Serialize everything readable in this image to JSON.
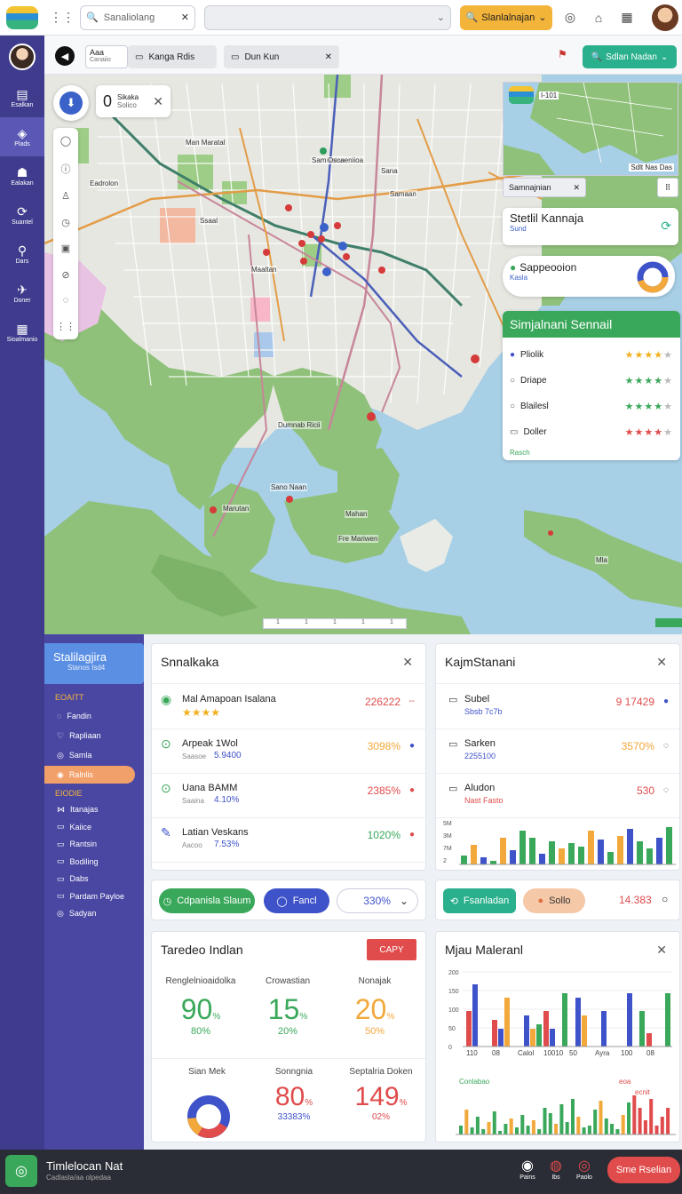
{
  "topbar": {
    "search_value": "Sanaliolang",
    "button_label": "Slanlalnajan",
    "icons": [
      "grid-icon",
      "search-icon",
      "close-icon",
      "chevron-icon",
      "compass-icon",
      "home-icon",
      "apps-icon"
    ]
  },
  "tabs": {
    "tab1_title": "Aaa",
    "tab1_sub": "Canaiio",
    "tab2": "Kanga Rdis",
    "tab3": "Dun Kun",
    "right_button": "Sdlan Nadan"
  },
  "sidebar": {
    "items": [
      {
        "label": "Esalkan",
        "icon": "inbox-icon"
      },
      {
        "label": "Plads",
        "icon": "layers-icon"
      },
      {
        "label": "Ealakan",
        "icon": "robot-icon"
      },
      {
        "label": "Suantel",
        "icon": "share-icon"
      },
      {
        "label": "Dars",
        "icon": "route-icon"
      },
      {
        "label": "Doner",
        "icon": "pin-icon"
      },
      {
        "label": "Sioalmanio",
        "icon": "calendar-icon"
      }
    ]
  },
  "map": {
    "popup_number": "0",
    "popup_title": "Sikaka",
    "popup_sub": "Solico",
    "labels": [
      "Man Maratal",
      "Samisalan",
      "Eadrolon",
      "Sana",
      "Oscaeniioa",
      "Samaan",
      "Ssaal",
      "Maaltan",
      "Dumnab Ricii",
      "Sano Naan",
      "Marutan",
      "Mahan",
      "Fre Mariwen",
      "Mla"
    ],
    "minimap_label": "Sdlt Nas Das",
    "minimap_tag": "I-101",
    "search_chip": "Samnajnian",
    "station_title": "Stetlil Kannaja",
    "station_sub": "Sund",
    "donut_title": "Sappeooion",
    "donut_sub": "Kasla",
    "list_title": "Simjalnani Sennail",
    "list_items": [
      {
        "label": "Pliolik",
        "rating": 4
      },
      {
        "label": "Driape",
        "rating": 4
      },
      {
        "label": "Blailesl",
        "rating": 4
      },
      {
        "label": "Doller",
        "rating": 4
      }
    ],
    "list_footer": "Rasch",
    "scale_ticks": [
      "1",
      "1",
      "1",
      "1",
      "1"
    ]
  },
  "left_menu": {
    "title": "Stalilagjira",
    "subtitle": "Stanos Isd4",
    "section1": "EOAITT",
    "items1": [
      "Fandin",
      "Rapliaan",
      "Samla",
      "Ralnlis"
    ],
    "section2": "EIODIE",
    "items2": [
      "Itanajas",
      "Kaiice",
      "Rantsin",
      "Bodiling",
      "Dabs",
      "Pardam Payloe",
      "Sadyan"
    ]
  },
  "panel1": {
    "title": "Snnalkaka",
    "rows": [
      {
        "title": "Mal Amapoan Isalana",
        "sub": "★★★★",
        "value": "226222",
        "suffix": "--",
        "color": "#e04b4b"
      },
      {
        "title": "Arpeak 1Wol",
        "sub": "Saasoe",
        "sub2": "5.9400",
        "value": "3098%",
        "suffix": "",
        "color": "#f2a83a"
      },
      {
        "title": "Uana BAMM",
        "sub": "Saaina",
        "sub2": "4.10%",
        "value": "2385%",
        "suffix": "",
        "color": "#e04b4b"
      },
      {
        "title": "Latian Veskans",
        "sub": "Aacoo",
        "sub2": "7.53%",
        "value": "1020%",
        "suffix": "",
        "color": "#3aa85b"
      }
    ]
  },
  "panel2": {
    "title": "KajmStanani",
    "rows": [
      {
        "title": "Subel",
        "sub": "Sbsb 7c7b",
        "value": "9 17429"
      },
      {
        "title": "Sarken",
        "sub": "2255100",
        "value": "3570%"
      },
      {
        "title": "Aludon",
        "sub": "Nast Fasto",
        "value": "530"
      }
    ],
    "chart_axis": [
      "5M",
      "3M",
      "7M",
      "2"
    ]
  },
  "chips": {
    "chip1": "Cdpanisla Slaum",
    "chip2": "Fancl",
    "select_value": "330%",
    "chip3": "Fsanladan",
    "chip4": "Sollo",
    "value": "14.383"
  },
  "panel3": {
    "title": "Taredeo Indlan",
    "button": "CAPY",
    "metrics": [
      {
        "label": "Renglelnioaidolka",
        "value": "90",
        "unit": "%",
        "sub": "80%",
        "color": "#3aa85b"
      },
      {
        "label": "Crowastian",
        "value": "15",
        "unit": "%",
        "sub": "20%",
        "color": "#3aa85b"
      },
      {
        "label": "Nonajak",
        "value": "20",
        "unit": "%",
        "sub": "50%",
        "color": "#f2a83a"
      }
    ],
    "metrics2": [
      {
        "label": "Sian Mek"
      },
      {
        "label": "Sonngnia",
        "value": "80",
        "unit": "%",
        "sub": "33383%",
        "color": "#e04b4b"
      },
      {
        "label": "Septalria Doken",
        "value": "149",
        "unit": "%",
        "sub": "02%",
        "color": "#e04b4b"
      }
    ]
  },
  "panel4": {
    "title": "Mjau Maleranl",
    "axis_labels": [
      "110",
      "08",
      "Calol",
      "10010",
      "50",
      "Ayra",
      "100",
      "08"
    ],
    "y_ticks": [
      "200",
      "150",
      "100",
      "50",
      "0"
    ],
    "legend": "Conlabao",
    "legend2": "eoa",
    "legend3": "ecnit"
  },
  "footer": {
    "title": "Timlelocan Nat",
    "sub": "Cadlasla/aa olpedaa",
    "items": [
      "Pains",
      "Ibs",
      "Paolo"
    ],
    "button": "Sme Rselian"
  },
  "colors": {
    "sidebar": "#3f3c8e",
    "green": "#3aa85b",
    "red": "#e04b4b",
    "orange": "#f2a83a",
    "blue": "#3e52c9",
    "accent": "#f3b43a"
  }
}
